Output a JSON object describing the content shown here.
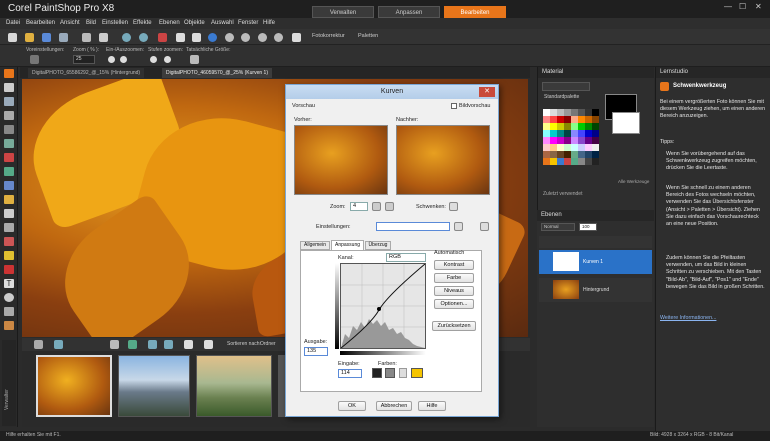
{
  "app": {
    "title": "Corel PaintShop Pro X8"
  },
  "workspace_tabs": [
    "Verwalten",
    "Anpassen",
    "Bearbeiten"
  ],
  "menu": [
    "Datei",
    "Bearbeiten",
    "Ansicht",
    "Bild",
    "Einstellen",
    "Effekte",
    "Ebenen",
    "Objekte",
    "Auswahl",
    "Fenster",
    "Hilfe"
  ],
  "toolbar": {
    "fotokorrektur": "Fotokorrektur",
    "paletten": "Paletten"
  },
  "tool_options": {
    "voreinstellungen": "Voreinstellungen:",
    "zoom_label": "Zoom ( % ):",
    "zoom_value": "25",
    "ein_auszoomen": "Ein-/Auszoomen:",
    "stufen_zoomen": "Stufen zoomen:",
    "tatsaechliche_groesse": "Tatsächliche Größe:"
  },
  "document_tabs": [
    {
      "label": "DigitalPHOTO_65586292_@_15% (Hintergrund)"
    },
    {
      "label": "DigitalPHOTO_46059570_@_25% (Kurven 1)"
    }
  ],
  "organizer": {
    "sort": "Sortieren nach:",
    "ordner": "Ordner",
    "side_label": "Verwalter"
  },
  "status": {
    "left": "Hilfe erhalten Sie mit F1.",
    "right": "Bild: 4928 x 3264 x RGB - 8 Bit/Kanal"
  },
  "material": {
    "title": "Material",
    "palette": "Standardpalette",
    "recent": "Zuletzt verwendet",
    "alle_werkzeuge": "Alle Werkzeuge"
  },
  "ebenen": {
    "title": "Ebenen",
    "mode": "Normal",
    "opacity": "100",
    "layers": [
      {
        "name": "Kurven 1"
      },
      {
        "name": "Hintergrund"
      }
    ]
  },
  "lernstudio": {
    "title": "Lernstudio",
    "tool": "Schwenkwerkzeug",
    "intro": "Bei einem vergrößerten Foto können Sie mit diesem Werkzeug ziehen, um einen anderen Bereich anzuzeigen.",
    "tips_label": "Tipps:",
    "tip1": "Wenn Sie vorübergehend auf das Schwenkwerkzeug zugreifen möchten, drücken Sie die Leertaste.",
    "tip2": "Wenn Sie schnell zu einem anderen Bereich des Fotos wechseln möchten, verwenden Sie das Übersichtsfenster (Ansicht > Paletten > Übersicht). Ziehen Sie dazu einfach das Vorschaurechteck an eine neue Position.",
    "tip3": "Zudem können Sie die Pfeiltasten verwenden, um das Bild in kleinen Schritten zu verschieben. Mit den Tasten \"Bild-Ab\", \"Bild-Auf\", \"Pos1\" und \"Ende\" bewegen Sie das Bild in großen Schritten.",
    "more": "Weitere Informationen..."
  },
  "dialog": {
    "title": "Kurven",
    "vorschau": "Vorschau",
    "bildvorschau": "Bildvorschau",
    "vorher": "Vorher:",
    "nachher": "Nachher:",
    "zoom_label": "Zoom:",
    "zoom_value": "4",
    "schwenken": "Schwenken:",
    "einstellungen": "Einstellungen:",
    "tabs": [
      "Allgemein",
      "Anpassung",
      "Überzug"
    ],
    "kanal_label": "Kanal:",
    "kanal_value": "RGB",
    "automatisch": "Automatisch",
    "btn_kontrast": "Kontrast",
    "btn_farbe": "Farbe",
    "btn_niveaus": "Niveaus",
    "btn_optionen": "Optionen...",
    "btn_zuruecksetzen": "Zurücksetzen",
    "ausgabe_label": "Ausgabe:",
    "ausgabe_value": "135",
    "eingabe_label": "Eingabe:",
    "eingabe_value": "114",
    "farben_label": "Farben:",
    "ok": "OK",
    "abbrechen": "Abbrechen",
    "hilfe": "Hilfe"
  },
  "colors": {
    "accent": "#e8751a",
    "fg_swatch": "#000000",
    "bg_swatch": "#ffffff",
    "farben_yellow": "#f5c400"
  }
}
